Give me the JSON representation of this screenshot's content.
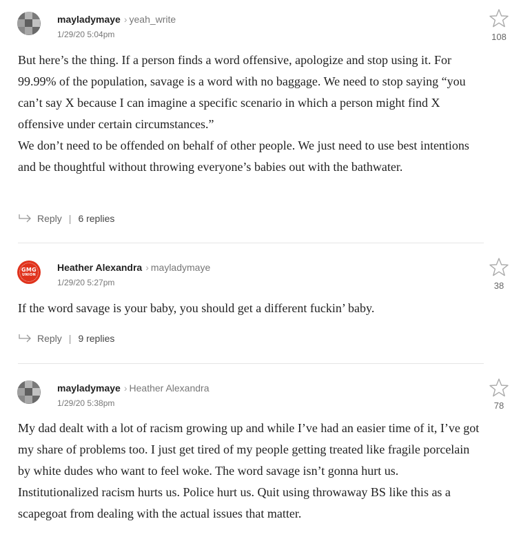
{
  "comments": [
    {
      "author": "mayladymaye",
      "reply_to": "yeah_write",
      "timestamp": "1/29/20 5:04pm",
      "star_count": "108",
      "avatar": "pixel-avatar",
      "paragraphs": [
        "But here’s the thing. If a person finds a word offensive, apologize and stop using it. For 99.99% of the population, savage is a word with no baggage. We need to stop saying “you can’t say X because I can imagine a specific scenario in which a person might find X offensive under certain circumstances.”",
        "We don’t need to be offended on behalf of other people. We just need to use best intentions and be thoughtful without throwing everyone’s babies out with the bathwater."
      ],
      "reply_label": "Reply",
      "replies_label": "6 replies"
    },
    {
      "author": "Heather Alexandra",
      "reply_to": "mayladymaye",
      "timestamp": "1/29/20 5:27pm",
      "star_count": "38",
      "avatar": "gmg-union-avatar",
      "avatar_text_top": "GMG",
      "avatar_text_bottom": "UNION",
      "paragraphs": [
        "If the word savage is your baby, you should get a different fuckin’ baby."
      ],
      "reply_label": "Reply",
      "replies_label": "9 replies"
    },
    {
      "author": "mayladymaye",
      "reply_to": "Heather Alexandra",
      "timestamp": "1/29/20 5:38pm",
      "star_count": "78",
      "avatar": "pixel-avatar",
      "paragraphs": [
        "My dad dealt with a lot of racism growing up and while I’ve had an easier time of it, I’ve got my share of problems too. I just get tired of my people getting treated like fragile porcelain by white dudes who want to feel woke. The word savage isn’t gonna hurt us. Institutionalized racism hurts us. Police hurt us. Quit using throwaway BS like this as a scapegoat from dealing with the actual issues that matter."
      ]
    }
  ],
  "colors": {
    "accent_red": "#e0321c",
    "star_stroke": "#aaaaaa",
    "divider": "#e5e5e5"
  }
}
